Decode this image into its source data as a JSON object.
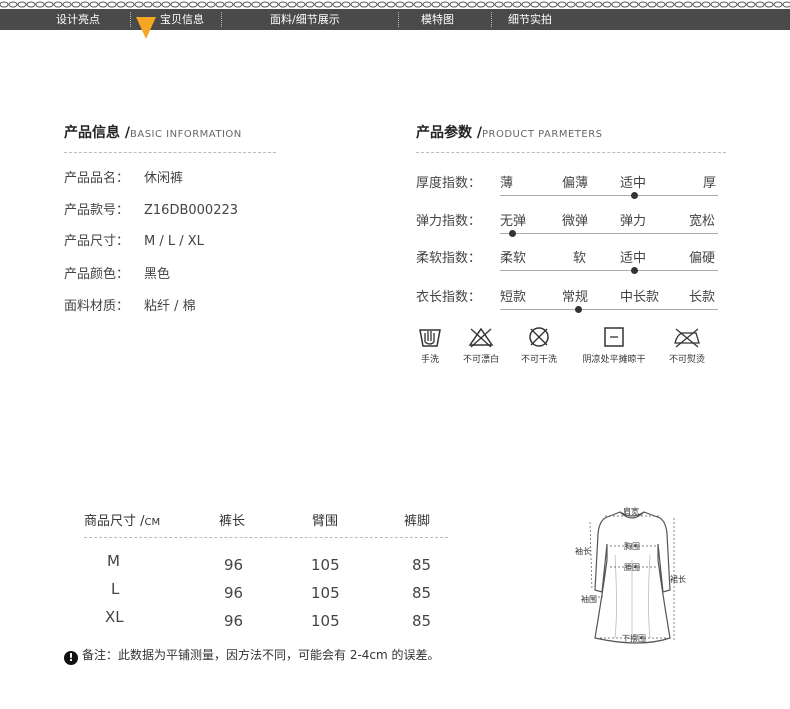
{
  "nav": {
    "items": [
      "设计亮点",
      "宝贝信息",
      "面料/细节展示",
      "模特图",
      "细节实拍"
    ],
    "active_index": 1,
    "bar_color": "#4a4a4a",
    "marker_color": "#f5a623"
  },
  "product_info": {
    "title": "产品信息 /",
    "title_en": "BASIC INFORMATION",
    "rows": [
      {
        "label": "产品品名：",
        "value": "休闲裤"
      },
      {
        "label": "产品款号：",
        "value": "Z16DB000223"
      },
      {
        "label": "产品尺寸：",
        "value": "M / L / XL"
      },
      {
        "label": "产品颜色：",
        "value": "黑色"
      },
      {
        "label": "面料材质：",
        "value": "粘纤 / 棉"
      }
    ]
  },
  "product_params": {
    "title": "产品参数 /",
    "title_en": "PRODUCT PARMETERS",
    "rows": [
      {
        "label": "厚度指数：",
        "options": [
          "薄",
          "偏薄",
          "适中",
          "厚"
        ],
        "selected_index": 2
      },
      {
        "label": "弹力指数：",
        "options": [
          "无弹",
          "微弹",
          "弹力",
          "宽松"
        ],
        "selected_index": 0
      },
      {
        "label": "柔软指数：",
        "options": [
          "柔软",
          "软",
          "适中",
          "偏硬"
        ],
        "selected_index": 2
      },
      {
        "label": "衣长指数：",
        "options": [
          "短款",
          "常规",
          "中长款",
          "长款"
        ],
        "selected_index": 1
      }
    ]
  },
  "care": [
    {
      "icon": "hand-wash-icon",
      "label": "手洗"
    },
    {
      "icon": "no-bleach-icon",
      "label": "不可漂白"
    },
    {
      "icon": "no-dry-clean-icon",
      "label": "不可干洗"
    },
    {
      "icon": "shade-dry-flat-icon",
      "label": "阴凉处平摊晾干"
    },
    {
      "icon": "no-iron-icon",
      "label": "不可熨烫"
    }
  ],
  "size_table": {
    "title": "商品尺寸 /",
    "unit": "CM",
    "columns": [
      "裤长",
      "臂围",
      "裤脚"
    ],
    "rows": [
      {
        "size": "M",
        "values": [
          "96",
          "105",
          "85"
        ]
      },
      {
        "size": "L",
        "values": [
          "96",
          "105",
          "85"
        ]
      },
      {
        "size": "XL",
        "values": [
          "96",
          "105",
          "85"
        ]
      }
    ]
  },
  "note": {
    "icon": "!",
    "text": "备注：此数据为平铺测量，因方法不同，可能会有 2-4cm 的误差。"
  },
  "measure_diagram": {
    "labels": {
      "shoulder": "肩宽",
      "sleeve": "袖长",
      "chest": "胸围",
      "waist": "腰围",
      "length": "裙长",
      "cuff": "袖围",
      "hem": "下摆围"
    }
  }
}
